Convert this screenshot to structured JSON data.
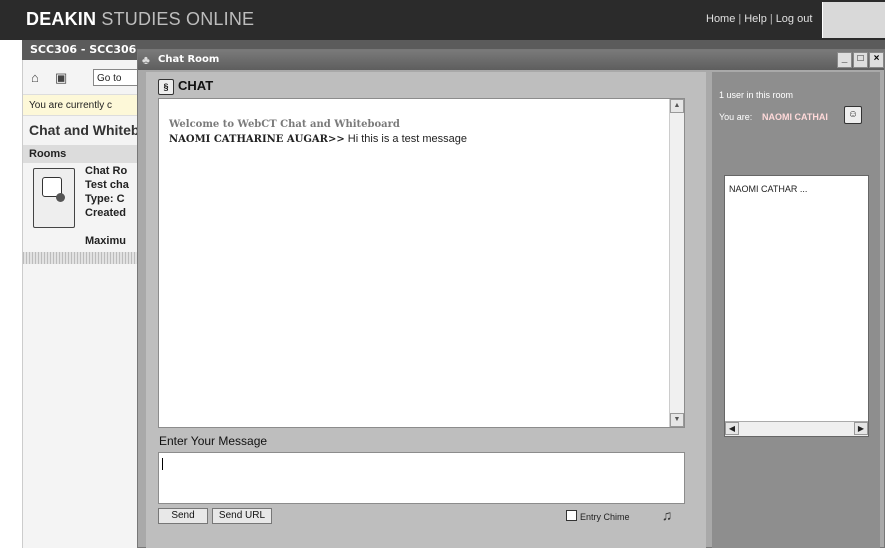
{
  "portal": {
    "brand_strong": "DEAKIN",
    "brand_light": "STUDIES ONLINE",
    "links": [
      "Home",
      "Help",
      "Log out"
    ],
    "course_code": "SCC306 - SCC306",
    "goto_label": "Go to",
    "status_text": "You are currently c",
    "heading": "Chat and Whiteb",
    "rooms_header": "Rooms",
    "room_lines": [
      "Chat Ro",
      "Test cha",
      "Type: C",
      "Created",
      "",
      "Maximu"
    ]
  },
  "chat_window": {
    "title": "Chat Room",
    "controls": [
      "_",
      "□",
      "×"
    ],
    "heading": "CHAT",
    "welcome": "Welcome to WebCT Chat and Whiteboard",
    "message_sender": "NAOMI CATHARINE AUGAR>>",
    "message_text": " Hi this is a test message",
    "input_label": "Enter Your Message",
    "send_label": "Send",
    "send_url_label": "Send URL",
    "chime_label": "Entry Chime"
  },
  "room_panel": {
    "users_count_text": "1 user in this room",
    "you_are_label": "You are:",
    "you_are_name": "NAOMI CATHAI",
    "users": [
      "NAOMI CATHAR ..."
    ]
  }
}
